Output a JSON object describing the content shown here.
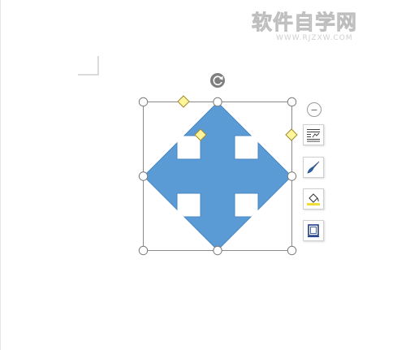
{
  "watermark": {
    "title": "软件自学网",
    "subtitle": "WWW.RJZXW.COM"
  },
  "shape": {
    "type": "quad-arrow",
    "fill_color": "#5b9bd5",
    "stroke_color": "#4a87c2"
  },
  "selection": {
    "handle_color": "#ffffff",
    "adjust_handle_color": "#fff59a",
    "frame_color": "#8a8a8a"
  },
  "side_toolbar": {
    "collapse_glyph": "−",
    "buttons": [
      {
        "name": "layout-options",
        "icon": "text-wrap-icon"
      },
      {
        "name": "shape-styles",
        "icon": "brush-icon"
      },
      {
        "name": "shape-fill",
        "icon": "fill-bucket-icon"
      },
      {
        "name": "shape-outline",
        "icon": "outline-icon"
      }
    ]
  }
}
